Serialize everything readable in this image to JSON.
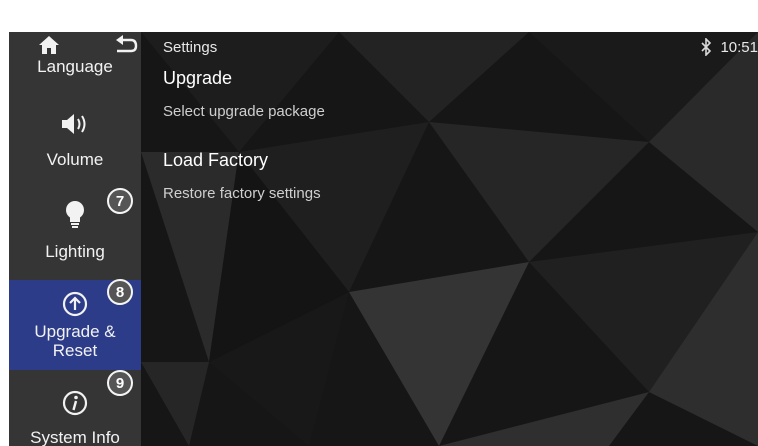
{
  "header": {
    "title": "Settings",
    "time": "10:51",
    "home_icon": "home-icon",
    "back_icon": "back-arrow-icon",
    "bluetooth_icon": "bluetooth-icon"
  },
  "sidebar": {
    "items": [
      {
        "label": "Language",
        "icon": "globe-icon"
      },
      {
        "label": "Volume",
        "icon": "speaker-icon"
      },
      {
        "label": "Lighting",
        "icon": "lightbulb-icon",
        "badge": "7"
      },
      {
        "label": "Upgrade &\nReset",
        "icon": "upload-circle-icon",
        "badge": "8",
        "selected": true
      },
      {
        "label": "System Info",
        "icon": "info-icon",
        "badge": "9"
      }
    ]
  },
  "main": {
    "options": [
      {
        "title": "Upgrade",
        "subtitle": "Select upgrade package"
      },
      {
        "title": "Load Factory",
        "subtitle": "Restore factory settings"
      }
    ]
  },
  "colors": {
    "selected": "#2c3c88",
    "background": "#161616",
    "text": "#ffffff",
    "subtext": "#cfcfcf"
  }
}
